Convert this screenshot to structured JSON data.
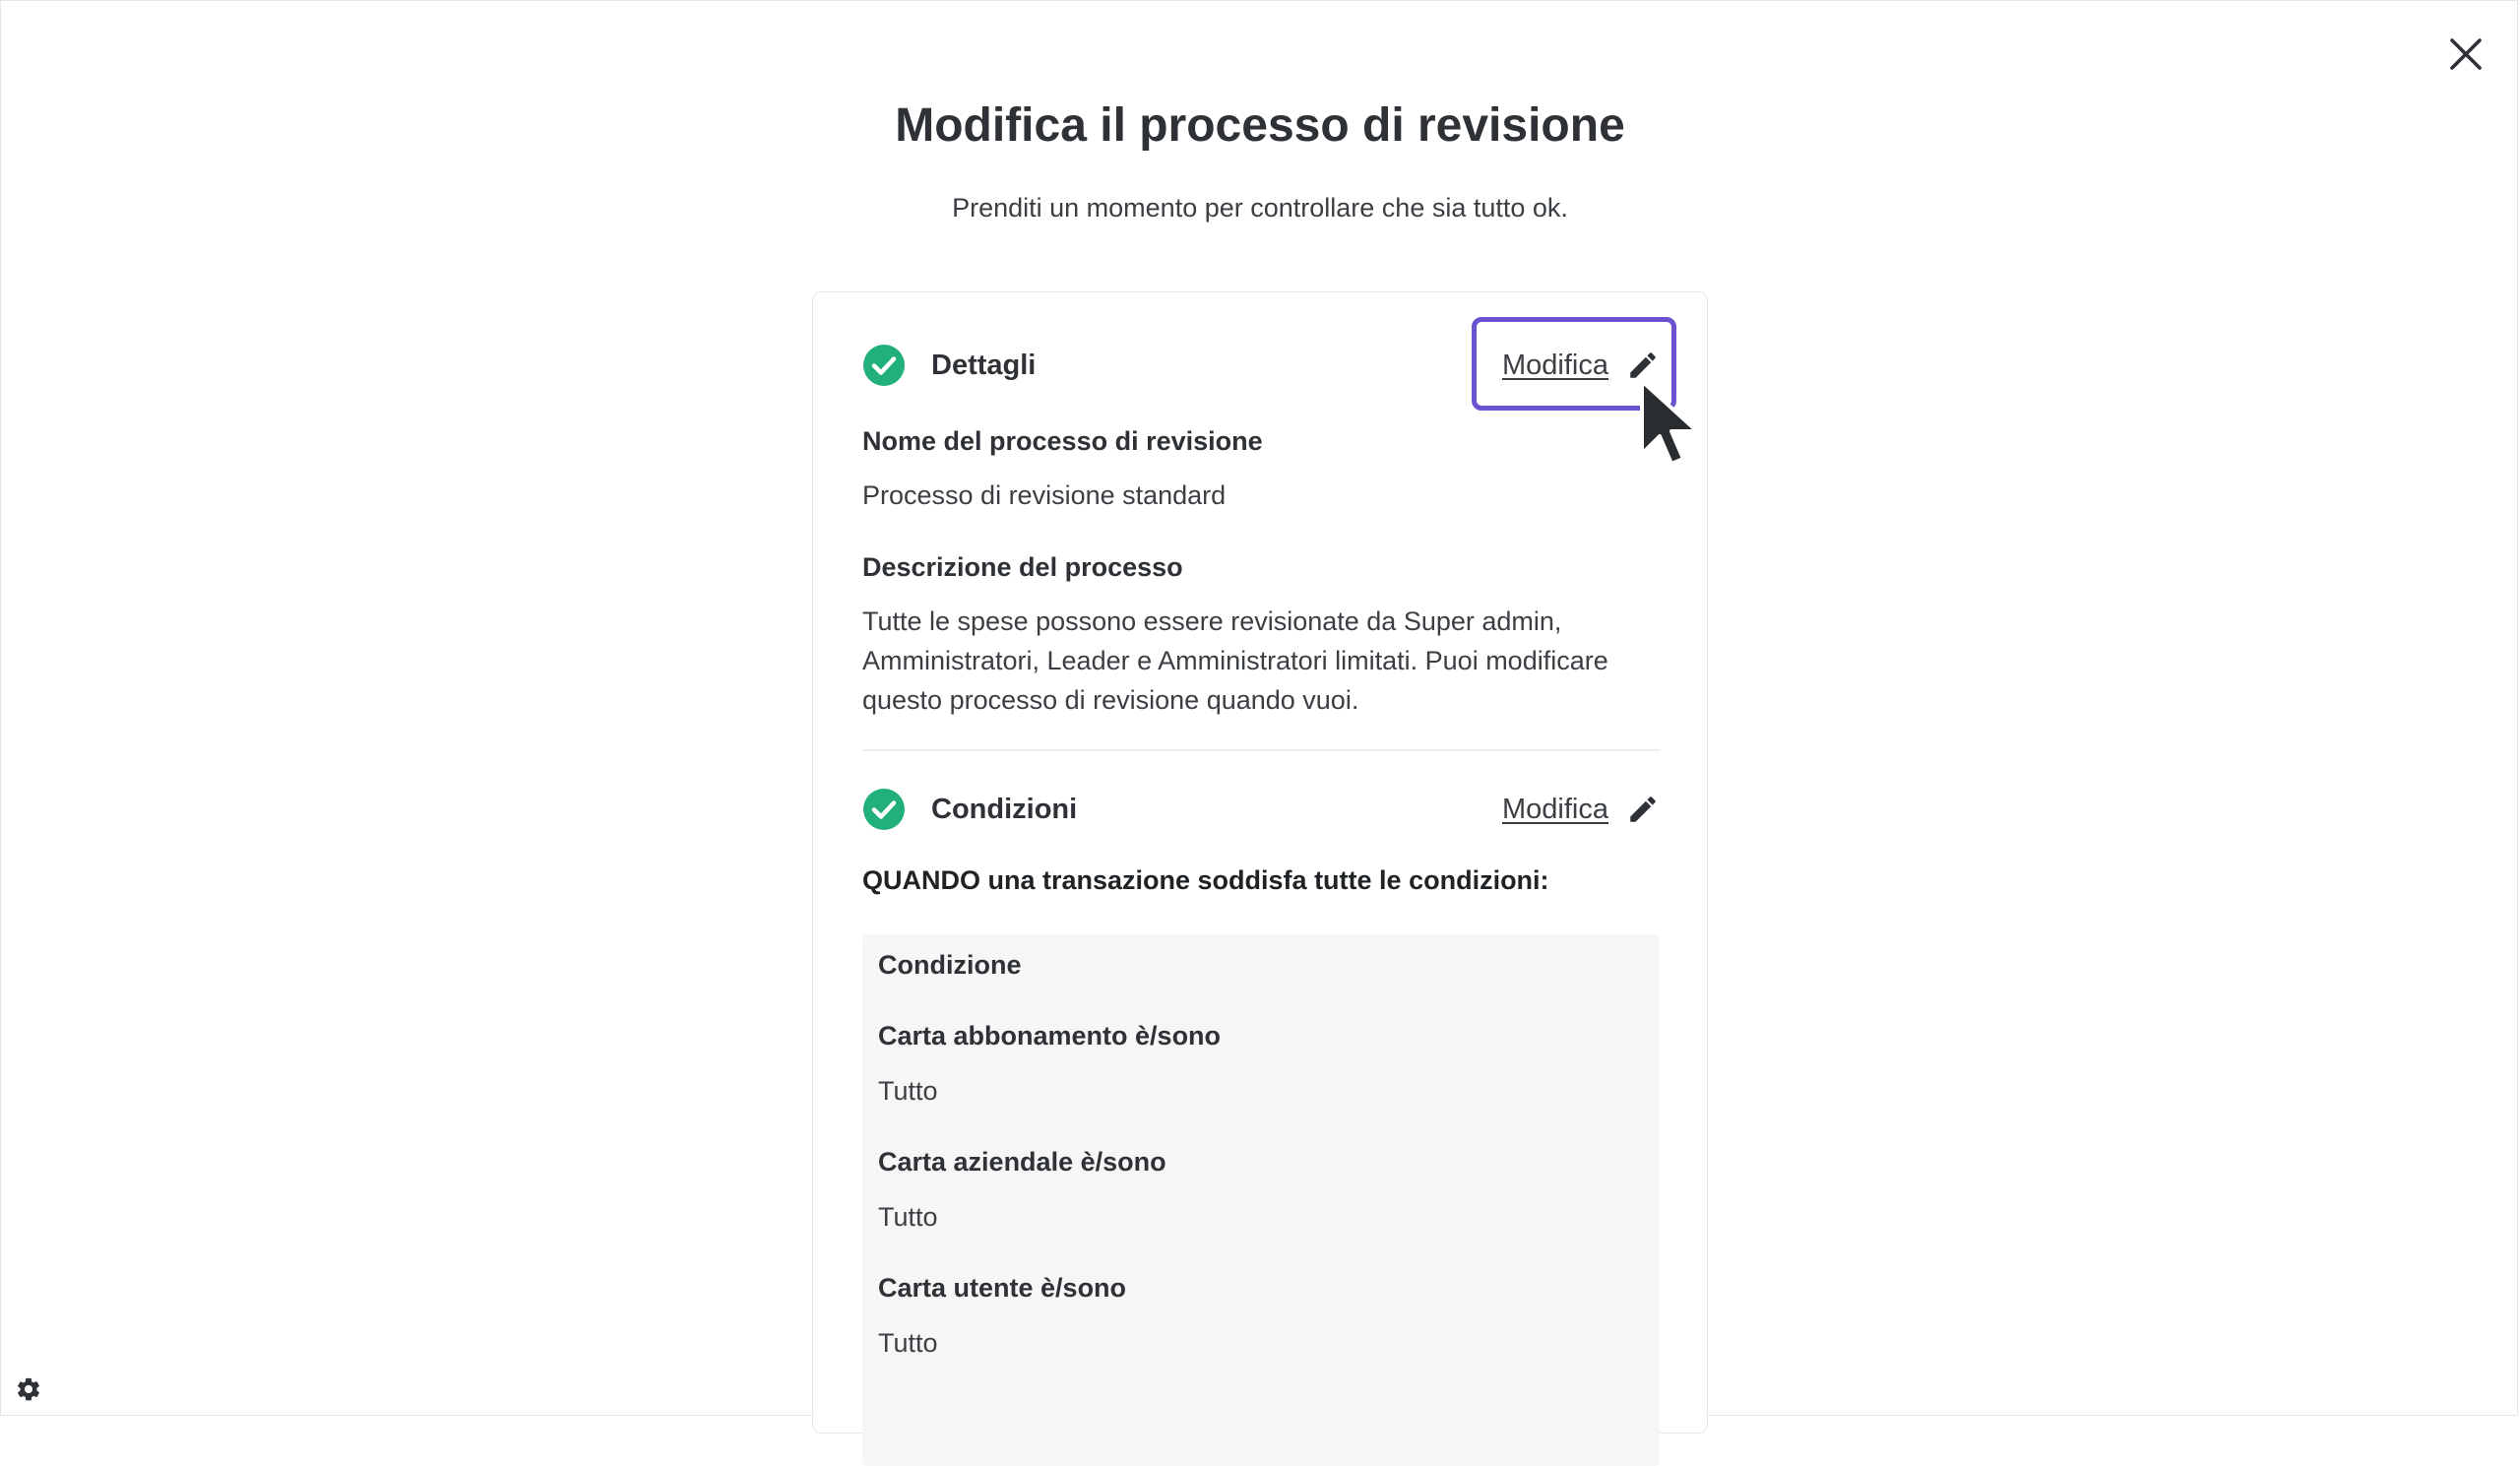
{
  "page": {
    "title": "Modifica il processo di revisione",
    "subtitle": "Prenditi un momento per controllare che sia tutto ok."
  },
  "icons": {
    "close": "close-icon",
    "settings": "gear-icon",
    "check": "check-circle-icon",
    "edit": "pencil-icon",
    "cursor": "mouse-pointer-icon"
  },
  "colors": {
    "success": "#21b07a",
    "focus_ring": "#6b52d1",
    "text_primary": "#2e3236",
    "panel_bg": "#f6f6f7"
  },
  "details": {
    "title": "Dettagli",
    "edit_label": "Modifica",
    "name_label": "Nome del processo di revisione",
    "name_value": "Processo di revisione standard",
    "description_label": "Descrizione del processo",
    "description_value": "Tutte le spese possono essere revisionate da Super admin, Amministratori, Leader e Amministratori limitati. Puoi modificare questo processo di revisione quando vuoi."
  },
  "conditions": {
    "title": "Condizioni",
    "edit_label": "Modifica",
    "when_text": "QUANDO una transazione soddisfa tutte le condizioni:",
    "box_header": "Condizione",
    "items": [
      {
        "label": "Carta abbonamento è/sono",
        "value": "Tutto"
      },
      {
        "label": "Carta aziendale è/sono",
        "value": "Tutto"
      },
      {
        "label": "Carta utente è/sono",
        "value": "Tutto"
      }
    ]
  }
}
